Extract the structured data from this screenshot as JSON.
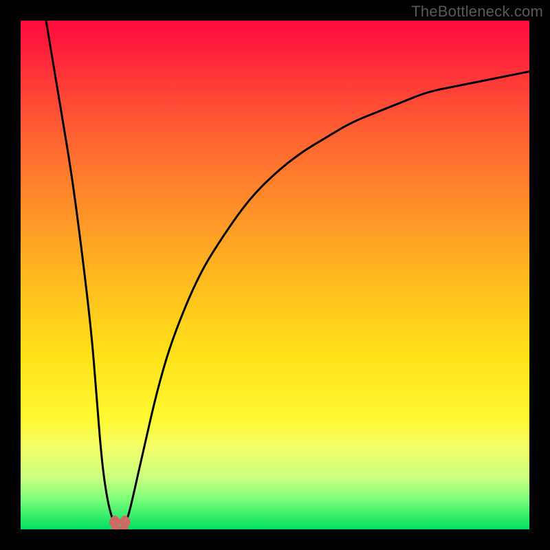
{
  "attribution": "TheBottleneck.com",
  "chart_data": {
    "type": "line",
    "title": "",
    "xlabel": "",
    "ylabel": "",
    "xlim": [
      0,
      100
    ],
    "ylim": [
      0,
      100
    ],
    "background_gradient": {
      "top_color": "#ff0a3c",
      "mid_color": "#ffe018",
      "bottom_color": "#00e060",
      "meaning": "top=worse, bottom=better"
    },
    "series": [
      {
        "name": "bottleneck-curve",
        "x": [
          5,
          8,
          10,
          12,
          14,
          15,
          16,
          17,
          18,
          19,
          20,
          21,
          22,
          24,
          27,
          30,
          35,
          40,
          45,
          50,
          55,
          60,
          65,
          70,
          75,
          80,
          85,
          90,
          95,
          100
        ],
        "y": [
          100,
          82,
          70,
          55,
          38,
          25,
          13,
          6,
          2,
          0,
          0,
          2,
          6,
          15,
          28,
          38,
          50,
          58,
          65,
          70,
          74,
          77,
          80,
          82,
          84,
          86,
          87,
          88,
          89,
          90
        ]
      }
    ],
    "markers": [
      {
        "name": "valley-left",
        "x": 18.5,
        "y": 1.5,
        "color": "#cc6b63"
      },
      {
        "name": "valley-right",
        "x": 20.5,
        "y": 1.5,
        "color": "#cc6b63"
      }
    ]
  }
}
